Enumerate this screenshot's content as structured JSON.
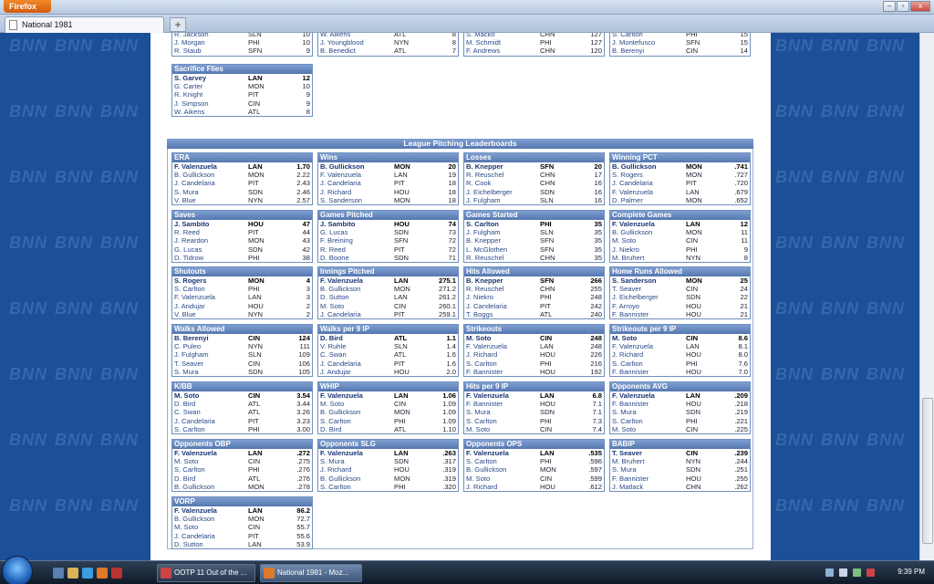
{
  "browser": {
    "menu_button": "Firefox",
    "tab_title": "National 1981",
    "new_tab": "+",
    "controls": [
      "–",
      "▫",
      "x"
    ]
  },
  "background_brand": "BNN",
  "prev_boards": [
    {
      "title": "",
      "rows": [
        [
          "R. Jackson",
          "SLN",
          "10"
        ],
        [
          "J. Morgan",
          "PHI",
          "10"
        ],
        [
          "R. Staub",
          "SFN",
          "9"
        ]
      ]
    },
    {
      "title": "",
      "rows": [
        [
          "W. Aikens",
          "ATL",
          "8"
        ],
        [
          "J. Youngblood",
          "NYN",
          "8"
        ],
        [
          "B. Benedict",
          "ATL",
          "7"
        ]
      ]
    },
    {
      "title": "",
      "rows": [
        [
          "S. Macko",
          "CHN",
          "127"
        ],
        [
          "M. Schmidt",
          "PHI",
          "127"
        ],
        [
          "F. Andrews",
          "CHN",
          "120"
        ]
      ]
    },
    {
      "title": "",
      "rows": [
        [
          "S. Carlton",
          "PHI",
          "15"
        ],
        [
          "J. Montefusco",
          "SFN",
          "15"
        ],
        [
          "B. Berenyi",
          "CIN",
          "14"
        ]
      ]
    }
  ],
  "sac_flies": {
    "title": "Sacrifice Flies",
    "rows": [
      [
        "S. Garvey",
        "LAN",
        "12"
      ],
      [
        "G. Carter",
        "MON",
        "10"
      ],
      [
        "R. Knight",
        "PIT",
        "9"
      ],
      [
        "J. Simpson",
        "CIN",
        "9"
      ],
      [
        "W. Aikens",
        "ATL",
        "8"
      ]
    ]
  },
  "section_title": "League Pitching Leaderboards",
  "boards": [
    {
      "title": "ERA",
      "rows": [
        [
          "F. Valenzuela",
          "LAN",
          "1.70"
        ],
        [
          "B. Gullickson",
          "MON",
          "2.22"
        ],
        [
          "J. Candelaria",
          "PIT",
          "2.43"
        ],
        [
          "S. Mura",
          "SDN",
          "2.46"
        ],
        [
          "V. Blue",
          "NYN",
          "2.57"
        ]
      ]
    },
    {
      "title": "Wins",
      "rows": [
        [
          "B. Gullickson",
          "MON",
          "20"
        ],
        [
          "F. Valenzuela",
          "LAN",
          "19"
        ],
        [
          "J. Candelaria",
          "PIT",
          "18"
        ],
        [
          "J. Richard",
          "HOU",
          "18"
        ],
        [
          "S. Sanderson",
          "MON",
          "18"
        ]
      ]
    },
    {
      "title": "Losses",
      "rows": [
        [
          "B. Knepper",
          "SFN",
          "20"
        ],
        [
          "R. Reuschel",
          "CHN",
          "17"
        ],
        [
          "R. Cook",
          "CHN",
          "16"
        ],
        [
          "J. Eichelberger",
          "SDN",
          "16"
        ],
        [
          "J. Fulgham",
          "SLN",
          "16"
        ]
      ]
    },
    {
      "title": "Winning PCT",
      "rows": [
        [
          "B. Gullickson",
          "MON",
          ".741"
        ],
        [
          "S. Rogers",
          "MON",
          ".727"
        ],
        [
          "J. Candelaria",
          "PIT",
          ".720"
        ],
        [
          "F. Valenzuela",
          "LAN",
          ".679"
        ],
        [
          "D. Palmer",
          "MON",
          ".652"
        ]
      ]
    },
    {
      "title": "Saves",
      "rows": [
        [
          "J. Sambito",
          "HOU",
          "47"
        ],
        [
          "R. Reed",
          "PIT",
          "44"
        ],
        [
          "J. Reardon",
          "MON",
          "43"
        ],
        [
          "G. Lucas",
          "SDN",
          "42"
        ],
        [
          "D. Tidrow",
          "PHI",
          "38"
        ]
      ]
    },
    {
      "title": "Games Pitched",
      "rows": [
        [
          "J. Sambito",
          "HOU",
          "74"
        ],
        [
          "G. Lucas",
          "SDN",
          "73"
        ],
        [
          "F. Breining",
          "SFN",
          "72"
        ],
        [
          "R. Reed",
          "PIT",
          "72"
        ],
        [
          "D. Boone",
          "SDN",
          "71"
        ]
      ]
    },
    {
      "title": "Games Started",
      "rows": [
        [
          "S. Carlton",
          "PHI",
          "35"
        ],
        [
          "J. Fulgham",
          "SLN",
          "35"
        ],
        [
          "B. Knepper",
          "SFN",
          "35"
        ],
        [
          "L. McGlothen",
          "SFN",
          "35"
        ],
        [
          "R. Reuschel",
          "CHN",
          "35"
        ]
      ]
    },
    {
      "title": "Complete Games",
      "rows": [
        [
          "F. Valenzuela",
          "LAN",
          "12"
        ],
        [
          "B. Gullickson",
          "MON",
          "11"
        ],
        [
          "M. Soto",
          "CIN",
          "11"
        ],
        [
          "J. Niekro",
          "PHI",
          "9"
        ],
        [
          "M. Bruhert",
          "NYN",
          "8"
        ]
      ]
    },
    {
      "title": "Shutouts",
      "rows": [
        [
          "S. Rogers",
          "MON",
          "4"
        ],
        [
          "S. Carlton",
          "PHI",
          "3"
        ],
        [
          "F. Valenzuela",
          "LAN",
          "3"
        ],
        [
          "J. Andujar",
          "HOU",
          "2"
        ],
        [
          "V. Blue",
          "NYN",
          "2"
        ]
      ]
    },
    {
      "title": "Innings Pitched",
      "rows": [
        [
          "F. Valenzuela",
          "LAN",
          "275.1"
        ],
        [
          "B. Gullickson",
          "MON",
          "271.2"
        ],
        [
          "D. Sutton",
          "LAN",
          "261.2"
        ],
        [
          "M. Soto",
          "CIN",
          "260.1"
        ],
        [
          "J. Candelaria",
          "PIT",
          "259.1"
        ]
      ]
    },
    {
      "title": "Hits Allowed",
      "rows": [
        [
          "B. Knepper",
          "SFN",
          "266"
        ],
        [
          "R. Reuschel",
          "CHN",
          "255"
        ],
        [
          "J. Niekro",
          "PHI",
          "248"
        ],
        [
          "J. Candelaria",
          "PIT",
          "242"
        ],
        [
          "T. Boggs",
          "ATL",
          "240"
        ]
      ]
    },
    {
      "title": "Home Runs Allowed",
      "rows": [
        [
          "S. Sanderson",
          "MON",
          "25"
        ],
        [
          "T. Seaver",
          "CIN",
          "24"
        ],
        [
          "J. Eichelberger",
          "SDN",
          "22"
        ],
        [
          "F. Arroyo",
          "HOU",
          "21"
        ],
        [
          "F. Bannister",
          "HOU",
          "21"
        ]
      ]
    },
    {
      "title": "Walks Allowed",
      "rows": [
        [
          "B. Berenyi",
          "CIN",
          "124"
        ],
        [
          "C. Puleo",
          "NYN",
          "111"
        ],
        [
          "J. Fulgham",
          "SLN",
          "109"
        ],
        [
          "T. Seaver",
          "CIN",
          "106"
        ],
        [
          "S. Mura",
          "SDN",
          "105"
        ]
      ]
    },
    {
      "title": "Walks per 9 IP",
      "rows": [
        [
          "D. Bird",
          "ATL",
          "1.1"
        ],
        [
          "V. Ruhle",
          "SLN",
          "1.4"
        ],
        [
          "C. Swan",
          "ATL",
          "1.6"
        ],
        [
          "J. Candelaria",
          "PIT",
          "1.6"
        ],
        [
          "J. Andujar",
          "HOU",
          "2.0"
        ]
      ]
    },
    {
      "title": "Strikeouts",
      "rows": [
        [
          "M. Soto",
          "CIN",
          "248"
        ],
        [
          "F. Valenzuela",
          "LAN",
          "248"
        ],
        [
          "J. Richard",
          "HOU",
          "226"
        ],
        [
          "S. Carlton",
          "PHI",
          "216"
        ],
        [
          "F. Bannister",
          "HOU",
          "192"
        ]
      ]
    },
    {
      "title": "Strikeouts per 9 IP",
      "rows": [
        [
          "M. Soto",
          "CIN",
          "8.6"
        ],
        [
          "F. Valenzuela",
          "LAN",
          "8.1"
        ],
        [
          "J. Richard",
          "HOU",
          "8.0"
        ],
        [
          "S. Carlton",
          "PHI",
          "7.6"
        ],
        [
          "F. Bannister",
          "HOU",
          "7.0"
        ]
      ]
    },
    {
      "title": "K/BB",
      "rows": [
        [
          "M. Soto",
          "CIN",
          "3.54"
        ],
        [
          "D. Bird",
          "ATL",
          "3.44"
        ],
        [
          "C. Swan",
          "ATL",
          "3.26"
        ],
        [
          "J. Candelaria",
          "PIT",
          "3.23"
        ],
        [
          "S. Carlton",
          "PHI",
          "3.00"
        ]
      ]
    },
    {
      "title": "WHIP",
      "rows": [
        [
          "F. Valenzuela",
          "LAN",
          "1.06"
        ],
        [
          "M. Soto",
          "CIN",
          "1.09"
        ],
        [
          "B. Gullickson",
          "MON",
          "1.09"
        ],
        [
          "S. Carlton",
          "PHI",
          "1.09"
        ],
        [
          "D. Bird",
          "ATL",
          "1.10"
        ]
      ]
    },
    {
      "title": "Hits per 9 IP",
      "rows": [
        [
          "F. Valenzuela",
          "LAN",
          "6.8"
        ],
        [
          "F. Bannister",
          "HOU",
          "7.1"
        ],
        [
          "S. Mura",
          "SDN",
          "7.1"
        ],
        [
          "S. Carlton",
          "PHI",
          "7.3"
        ],
        [
          "M. Soto",
          "CIN",
          "7.4"
        ]
      ]
    },
    {
      "title": "Opponents AVG",
      "rows": [
        [
          "F. Valenzuela",
          "LAN",
          ".209"
        ],
        [
          "F. Bannister",
          "HOU",
          ".218"
        ],
        [
          "S. Mura",
          "SDN",
          ".219"
        ],
        [
          "S. Carlton",
          "PHI",
          ".221"
        ],
        [
          "M. Soto",
          "CIN",
          ".225"
        ]
      ]
    },
    {
      "title": "Opponents OBP",
      "rows": [
        [
          "F. Valenzuela",
          "LAN",
          ".272"
        ],
        [
          "M. Soto",
          "CIN",
          ".275"
        ],
        [
          "S. Carlton",
          "PHI",
          ".276"
        ],
        [
          "D. Bird",
          "ATL",
          ".276"
        ],
        [
          "B. Gullickson",
          "MON",
          ".278"
        ]
      ]
    },
    {
      "title": "Opponents SLG",
      "rows": [
        [
          "F. Valenzuela",
          "LAN",
          ".263"
        ],
        [
          "S. Mura",
          "SDN",
          ".317"
        ],
        [
          "J. Richard",
          "HOU",
          ".319"
        ],
        [
          "B. Gullickson",
          "MON",
          ".319"
        ],
        [
          "S. Carlton",
          "PHI",
          ".320"
        ]
      ]
    },
    {
      "title": "Opponents OPS",
      "rows": [
        [
          "F. Valenzuela",
          "LAN",
          ".535"
        ],
        [
          "S. Carlton",
          "PHI",
          ".596"
        ],
        [
          "B. Gullickson",
          "MON",
          ".597"
        ],
        [
          "M. Soto",
          "CIN",
          ".599"
        ],
        [
          "J. Richard",
          "HOU",
          ".612"
        ]
      ]
    },
    {
      "title": "BABIP",
      "rows": [
        [
          "T. Seaver",
          "CIN",
          ".239"
        ],
        [
          "M. Bruhert",
          "NYN",
          ".244"
        ],
        [
          "S. Mura",
          "SDN",
          ".251"
        ],
        [
          "F. Bannister",
          "HOU",
          ".255"
        ],
        [
          "J. Matlack",
          "CHN",
          ".262"
        ]
      ]
    },
    {
      "title": "VORP",
      "rows": [
        [
          "F. Valenzuela",
          "LAN",
          "86.2"
        ],
        [
          "B. Gullickson",
          "MON",
          "72.7"
        ],
        [
          "M. Soto",
          "CIN",
          "55.7"
        ],
        [
          "J. Candelaria",
          "PIT",
          "55.6"
        ],
        [
          "D. Sutton",
          "LAN",
          "53.9"
        ]
      ]
    }
  ],
  "taskbar": {
    "tasks": [
      "OOTP 11 Out of the ...",
      "National 1981 - Moz..."
    ],
    "clock": "9:39 PM"
  }
}
